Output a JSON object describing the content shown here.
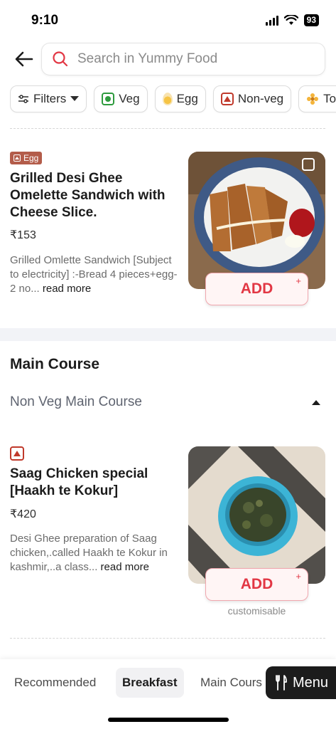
{
  "status_bar": {
    "time": "9:10",
    "battery": "93"
  },
  "header": {
    "search_placeholder": "Search in Yummy Food"
  },
  "filters": [
    {
      "label": "Filters",
      "icon": "sliders-icon"
    },
    {
      "label": "Veg",
      "icon": "veg-icon"
    },
    {
      "label": "Egg",
      "icon": "egg-icon"
    },
    {
      "label": "Non-veg",
      "icon": "nonveg-icon"
    },
    {
      "label": "To",
      "icon": "flower-icon"
    }
  ],
  "items": [
    {
      "badge": "Egg",
      "title": "Grilled Desi Ghee Omelette Sandwich with Cheese Slice.",
      "price": "₹153",
      "description": "Grilled Omlette Sandwich [Subject to electricity] :-Bread 4 pieces+egg-2 no...",
      "read_more": "read more",
      "add_label": "ADD",
      "add_plus": "+"
    },
    {
      "title": "Saag Chicken special [Haakh te Kokur]",
      "price": "₹420",
      "description": "Desi Ghee preparation of Saag chicken,.called Haakh te Kokur in kashmir,..a class...",
      "read_more": "read more",
      "add_label": "ADD",
      "add_plus": "+",
      "customisable": "customisable"
    }
  ],
  "section": {
    "title": "Main Course",
    "subtitle": "Non Veg Main Course"
  },
  "bottom_nav": {
    "tabs": [
      "Recommended",
      "Breakfast",
      "Main Cours"
    ],
    "active": "Breakfast",
    "menu_label": "Menu"
  },
  "colors": {
    "accent": "#e23744",
    "veg": "#2e9b3e",
    "nonveg": "#c0392b",
    "egg_badge": "#b35c4a"
  }
}
